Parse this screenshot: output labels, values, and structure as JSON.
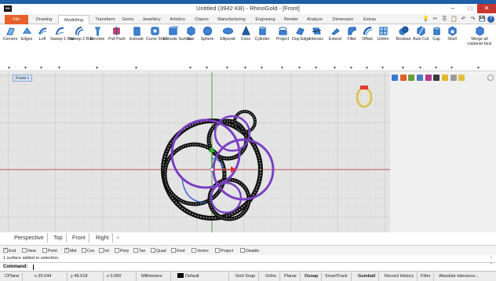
{
  "window": {
    "title": "Untitled (3942 KB) - RhinoGold - [Front]",
    "logo_text": "RG",
    "minimize": "–",
    "maximize": "□",
    "close": "✕"
  },
  "tabs": [
    {
      "label": "File"
    },
    {
      "label": "Drawing"
    },
    {
      "label": "Modelling"
    },
    {
      "label": "Transform"
    },
    {
      "label": "Gems"
    },
    {
      "label": "Jewellery"
    },
    {
      "label": "Artistics"
    },
    {
      "label": "Clayoo"
    },
    {
      "label": "Manufacturing"
    },
    {
      "label": "Engraving"
    },
    {
      "label": "Render"
    },
    {
      "label": "Analyze"
    },
    {
      "label": "Dimension"
    },
    {
      "label": "Extras"
    }
  ],
  "ribbon_right_icons": [
    "lamp-icon",
    "cut-icon",
    "copy-icon",
    "paste-icon",
    "undo-icon",
    "redo-icon",
    "save-icon",
    "help-icon"
  ],
  "ribbon_right_glyphs": [
    "💡",
    "✂",
    "⎘",
    "📋",
    "↶",
    "↷",
    "💾",
    "?"
  ],
  "tools": [
    {
      "label": "Corners",
      "icon": "corners-icon"
    },
    {
      "label": "Edges",
      "icon": "edges-icon"
    },
    {
      "label": "Loft",
      "icon": "loft-icon"
    },
    {
      "label": "Sweep 1 Rail",
      "icon": "sweep1-icon"
    },
    {
      "label": "Sweep 2 Rail",
      "icon": "sweep2-icon"
    },
    {
      "label": "Revolve",
      "icon": "revolve-icon"
    },
    {
      "label": "Pull Push",
      "icon": "pull-push-icon"
    },
    {
      "label": "Extrude",
      "icon": "extrude-icon"
    },
    {
      "label": "Curve Shell",
      "icon": "curve-shell-icon"
    },
    {
      "label": "Extrude Surface",
      "icon": "extrude-surface-icon"
    },
    {
      "label": "Box",
      "icon": "box-icon"
    },
    {
      "label": "Sphere",
      "icon": "sphere-icon"
    },
    {
      "label": "Ellipsoid",
      "icon": "ellipsoid-icon"
    },
    {
      "label": "Cone",
      "icon": "cone-icon"
    },
    {
      "label": "Cylinder",
      "icon": "cylinder-icon"
    },
    {
      "label": "Project",
      "icon": "project-icon"
    },
    {
      "label": "Dup Edge",
      "icon": "dup-edge-icon"
    },
    {
      "label": "Intersec",
      "icon": "intersect-icon"
    },
    {
      "label": "Extend",
      "icon": "extend-icon"
    },
    {
      "label": "Fillet",
      "icon": "fillet-icon"
    },
    {
      "label": "Offset",
      "icon": "offset-icon"
    },
    {
      "label": "Untrim",
      "icon": "untrim-icon"
    },
    {
      "label": "Boolean",
      "icon": "boolean-icon"
    },
    {
      "label": "Auto Cut",
      "icon": "auto-cut-icon"
    },
    {
      "label": "Cap",
      "icon": "cap-icon"
    },
    {
      "label": "Shell",
      "icon": "shell-icon"
    },
    {
      "label": "Merge all coplanar face",
      "icon": "merge-coplanar-icon"
    }
  ],
  "ribbon_dropdown_glyph": "▾",
  "viewport": {
    "label": "Front",
    "tabs": [
      "Perspective",
      "Top",
      "Front",
      "Right",
      "+"
    ]
  },
  "osnaps": [
    {
      "label": "End",
      "checked": true
    },
    {
      "label": "Near",
      "checked": false
    },
    {
      "label": "Point",
      "checked": false
    },
    {
      "label": "Mid",
      "checked": true
    },
    {
      "label": "Cen",
      "checked": false
    },
    {
      "label": "Int",
      "checked": false
    },
    {
      "label": "Perp",
      "checked": false
    },
    {
      "label": "Tan",
      "checked": false
    },
    {
      "label": "Quad",
      "checked": false
    },
    {
      "label": "Knot",
      "checked": false
    },
    {
      "label": "Vertex",
      "checked": false
    },
    {
      "label": "Project",
      "checked": false
    },
    {
      "label": "Disable",
      "checked": false
    }
  ],
  "command": {
    "history": "1 surface added to selection.",
    "prompt": "Command:"
  },
  "status": {
    "cplane": "CPlane",
    "x": "x 25.044",
    "y": "y 46.518",
    "z": "z 0.000",
    "units": "Millimeters",
    "layer": "Default",
    "grid_snap": "Grid Snap",
    "ortho": "Ortho",
    "planar": "Planar",
    "osnap": "Osnap",
    "smarttrack": "SmartTrack",
    "gumball": "Gumball",
    "record_history": "Record History",
    "filter": "Filter",
    "tolerance": "Absolute tolerance..."
  },
  "colors": {
    "file_tab": "#e8612c",
    "title_accent": "#1f5fa8",
    "close_button": "#c7372f",
    "curve_purple": "#7a3fc4",
    "x_axis": "#b03030",
    "y_axis": "#2e8b2e"
  }
}
